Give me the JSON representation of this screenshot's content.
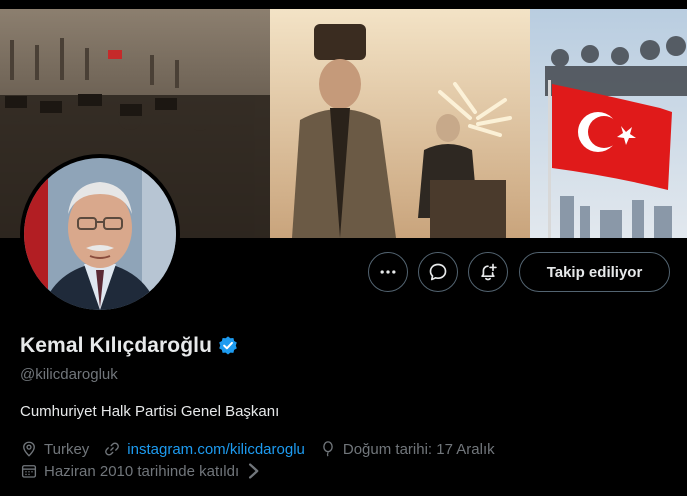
{
  "profile": {
    "display_name": "Kemal Kılıçdaroğlu",
    "handle": "@kilicdarogluk",
    "bio": "Cumhuriyet Halk Partisi Genel Başkanı",
    "location": "Turkey",
    "website": "instagram.com/kilicdaroglu",
    "birthday": "Doğum tarihi: 17 Aralık",
    "joined": "Haziran 2010 tarihinde katıldı"
  },
  "actions": {
    "follow_label": "Takip ediliyor"
  },
  "icons": {
    "more": "more-horizontal-icon",
    "message": "message-icon",
    "notify": "notification-bell-plus-icon",
    "verified": "verified-badge-icon",
    "location": "location-pin-icon",
    "link": "link-icon",
    "birthday": "balloon-icon",
    "calendar": "calendar-icon",
    "chevron": "chevron-right-icon"
  },
  "colors": {
    "background": "#000000",
    "text_primary": "#e7e9ea",
    "text_secondary": "#71767b",
    "accent": "#1d9bf0",
    "button_border": "#536471"
  }
}
